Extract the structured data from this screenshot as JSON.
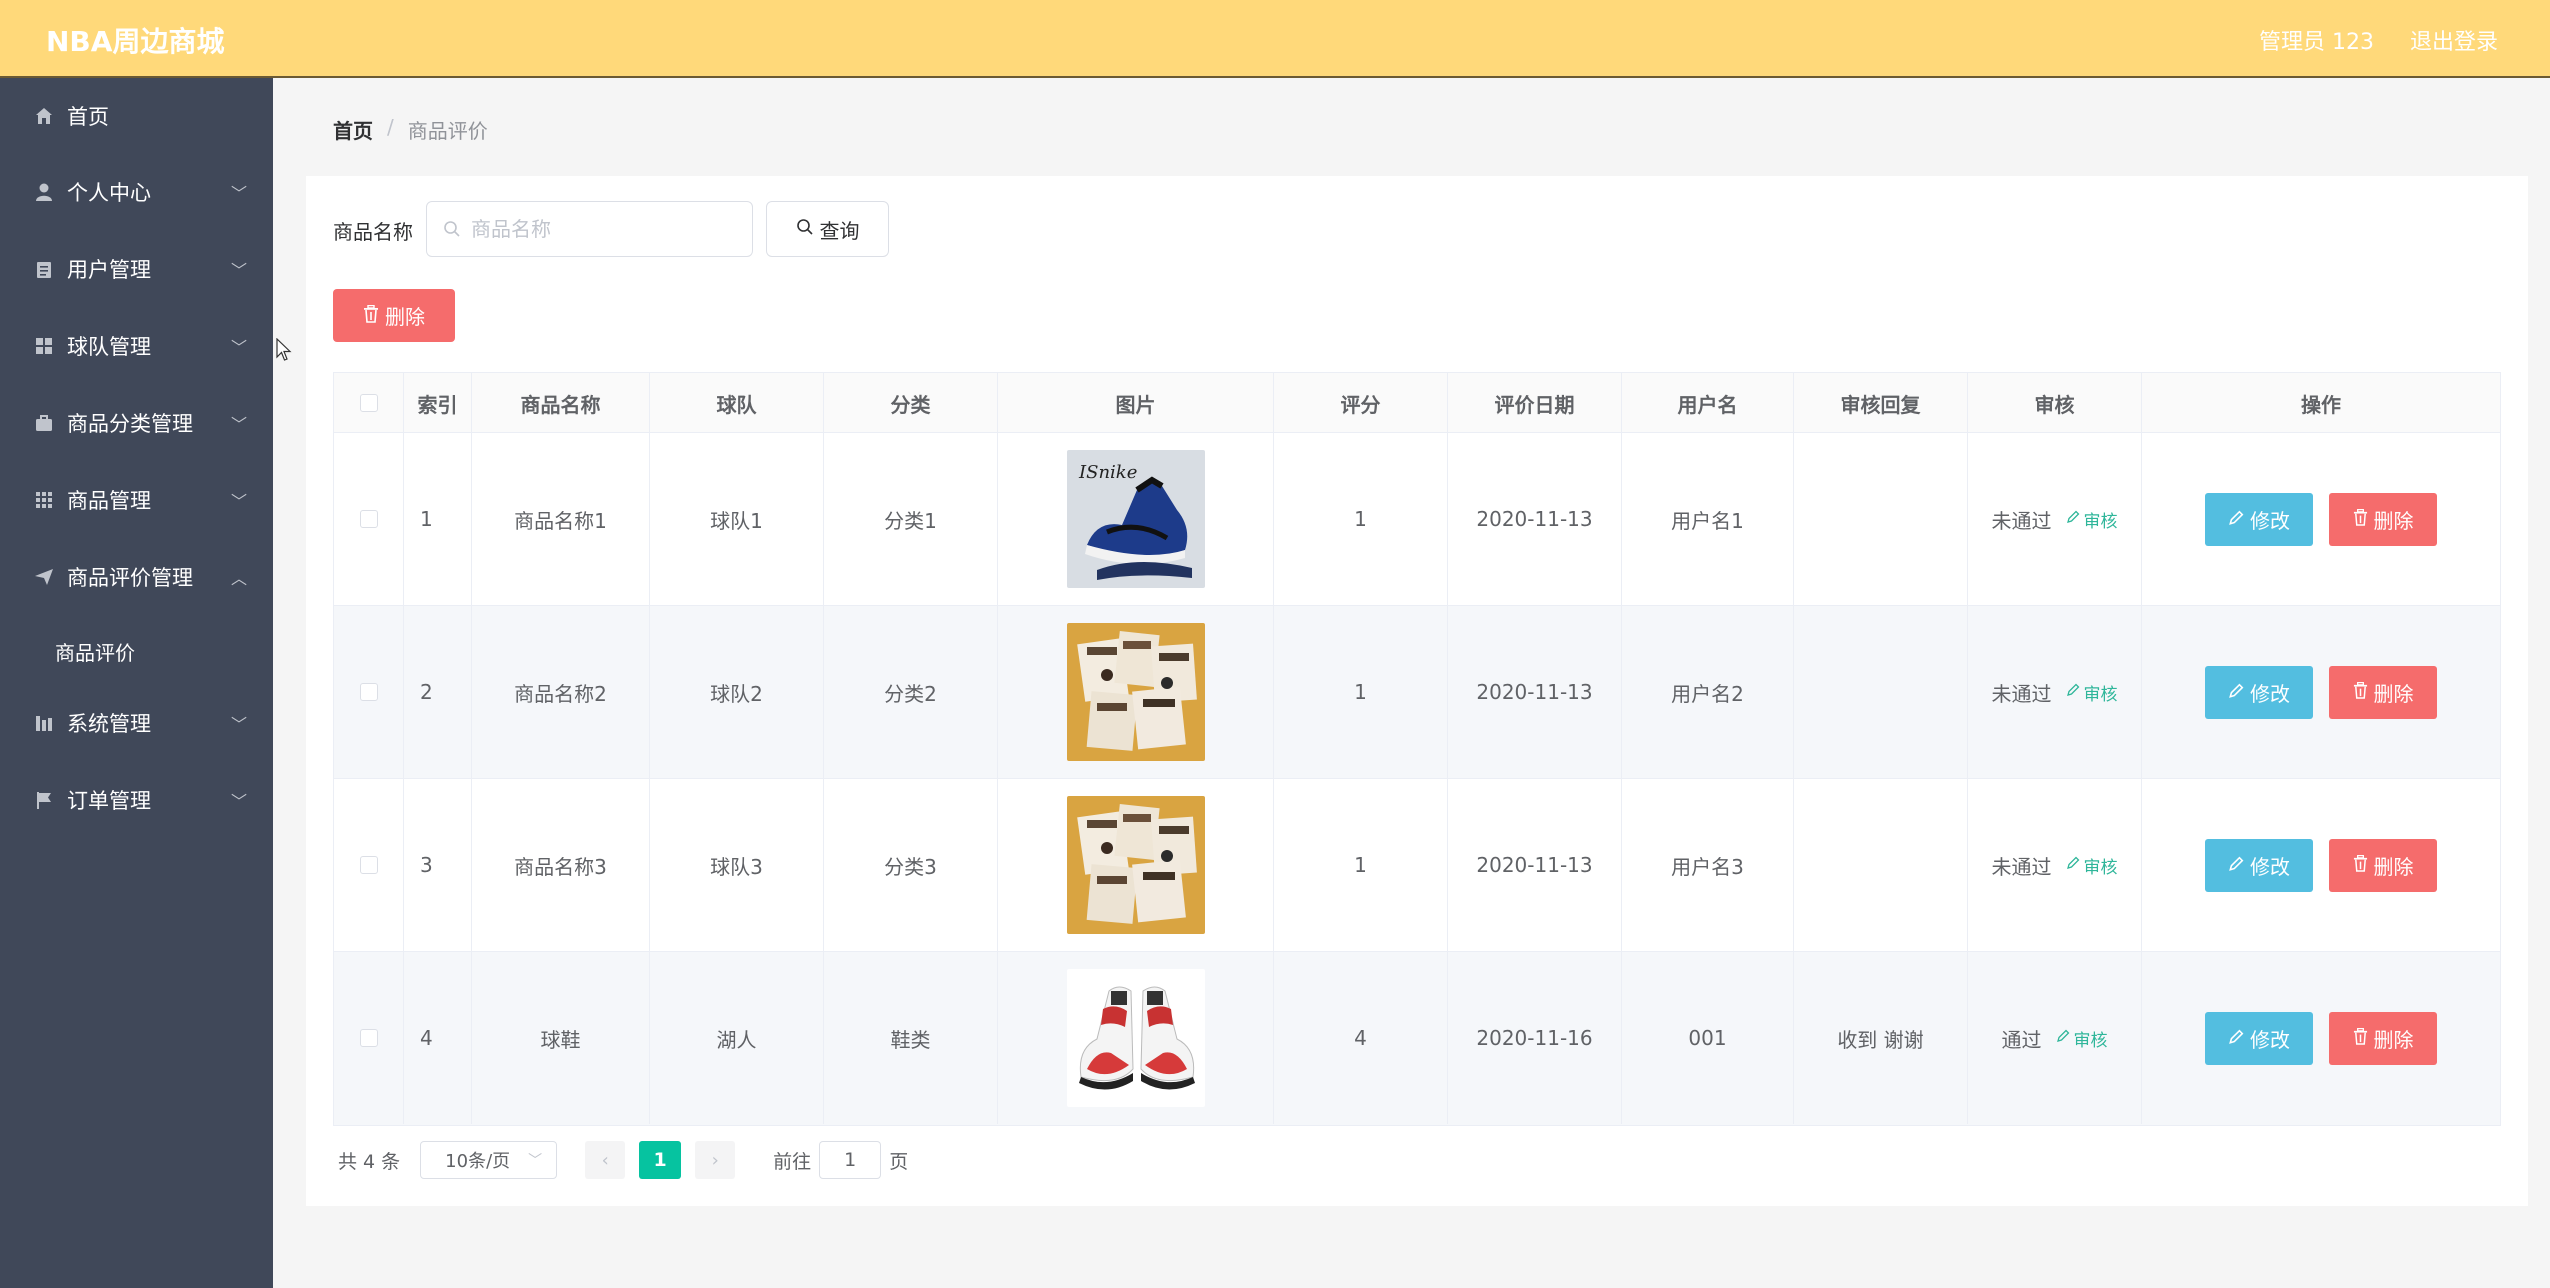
{
  "header": {
    "brand": "NBA周边商城",
    "admin_label": "管理员 123",
    "logout_label": "退出登录"
  },
  "sidebar": {
    "items": [
      {
        "label": "首页",
        "icon": "home-icon",
        "has_arrow": false
      },
      {
        "label": "个人中心",
        "icon": "user-icon",
        "has_arrow": true
      },
      {
        "label": "用户管理",
        "icon": "clipboard-icon",
        "has_arrow": true
      },
      {
        "label": "球队管理",
        "icon": "grid-icon",
        "has_arrow": true
      },
      {
        "label": "商品分类管理",
        "icon": "briefcase-icon",
        "has_arrow": true
      },
      {
        "label": "商品管理",
        "icon": "apps-icon",
        "has_arrow": true
      },
      {
        "label": "商品评价管理",
        "icon": "send-icon",
        "has_arrow": true,
        "expanded": true
      },
      {
        "label": "系统管理",
        "icon": "chart-icon",
        "has_arrow": true
      },
      {
        "label": "订单管理",
        "icon": "flag-icon",
        "has_arrow": true
      }
    ],
    "submenu_active": "商品评价"
  },
  "breadcrumb": {
    "home": "首页",
    "separator": "/",
    "current": "商品评价"
  },
  "search": {
    "label": "商品名称",
    "placeholder": "商品名称",
    "value": "",
    "query_label": "查询"
  },
  "toolbar": {
    "delete_label": "删除"
  },
  "table": {
    "headers": [
      "",
      "索引",
      "商品名称",
      "球队",
      "分类",
      "图片",
      "评分",
      "评价日期",
      "用户名",
      "审核回复",
      "审核",
      "操作"
    ],
    "rows": [
      {
        "index": "1",
        "name": "商品名称1",
        "team": "球队1",
        "category": "分类1",
        "image": "blue-sneaker",
        "score": "1",
        "date": "2020-11-13",
        "user": "用户名1",
        "reply": "",
        "status": "未通过"
      },
      {
        "index": "2",
        "name": "商品名称2",
        "team": "球队2",
        "category": "分类2",
        "image": "photo-collage",
        "score": "1",
        "date": "2020-11-13",
        "user": "用户名2",
        "reply": "",
        "status": "未通过"
      },
      {
        "index": "3",
        "name": "商品名称3",
        "team": "球队3",
        "category": "分类3",
        "image": "photo-collage",
        "score": "1",
        "date": "2020-11-13",
        "user": "用户名3",
        "reply": "",
        "status": "未通过"
      },
      {
        "index": "4",
        "name": "球鞋",
        "team": "湖人",
        "category": "鞋类",
        "image": "red-sneaker",
        "score": "4",
        "date": "2020-11-16",
        "user": "001",
        "reply": "收到 谢谢",
        "status": "通过"
      }
    ],
    "audit_label": "审核",
    "edit_label": "修改",
    "delete_label": "删除"
  },
  "pagination": {
    "total": "共 4 条",
    "page_size": "10条/页",
    "current_page": "1",
    "goto_prefix": "前往",
    "goto_value": "1",
    "goto_suffix": "页"
  },
  "colors": {
    "header_bg": "#ffd97a",
    "sidebar_bg": "#404859",
    "danger": "#f56c6c",
    "info": "#53bee0",
    "accent": "#06c3a0",
    "audit_link": "#2fb69a"
  }
}
